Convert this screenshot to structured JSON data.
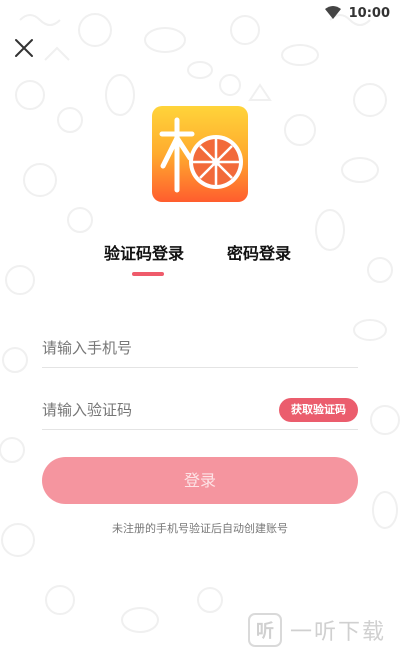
{
  "status_bar": {
    "time": "10:00",
    "wifi_icon": "wifi-icon"
  },
  "header": {
    "close_icon": "close-icon"
  },
  "logo": {
    "char": "柚",
    "icon": "grapefruit-icon"
  },
  "tabs": [
    {
      "label": "验证码登录",
      "active": true
    },
    {
      "label": "密码登录",
      "active": false
    }
  ],
  "form": {
    "phone": {
      "placeholder": "请输入手机号",
      "value": ""
    },
    "code": {
      "placeholder": "请输入验证码",
      "value": ""
    },
    "get_code_label": "获取验证码",
    "submit_label": "登录"
  },
  "hint": "未注册的手机号验证后自动创建账号",
  "watermark": {
    "badge": "听",
    "text": "一听下载"
  },
  "colors": {
    "accent": "#eb5d6d",
    "button_disabled": "#f5959f",
    "logo_top": "#ffd43a",
    "logo_bottom": "#ff5d2e"
  }
}
